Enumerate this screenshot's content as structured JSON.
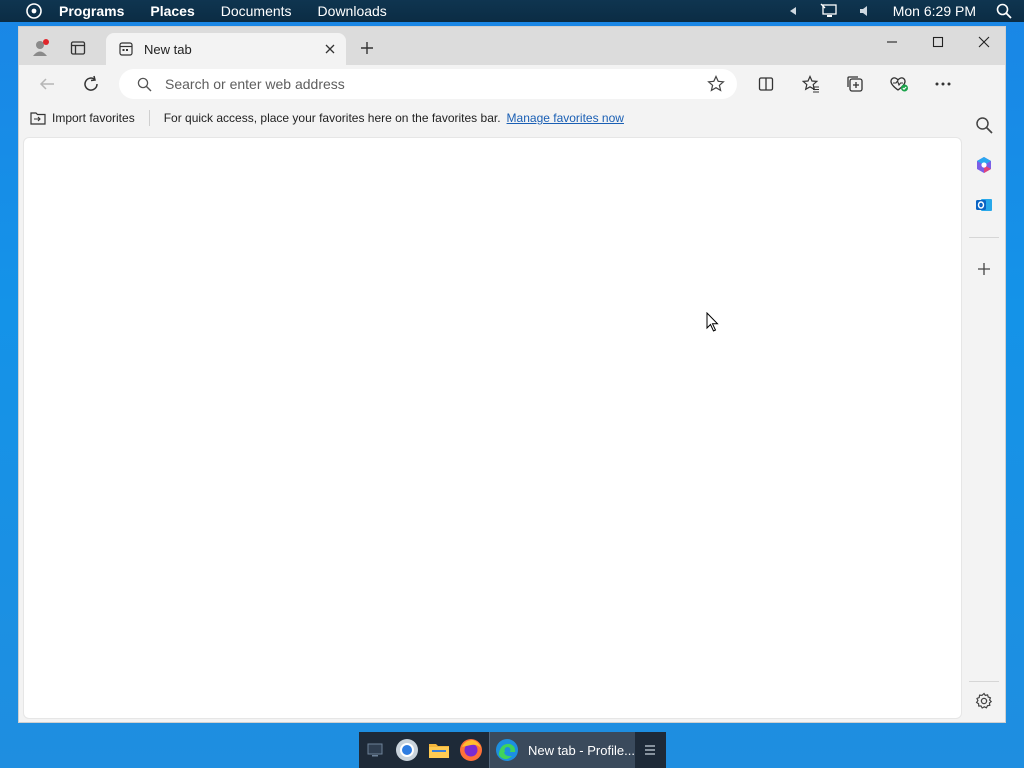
{
  "top_panel": {
    "menu": [
      "Programs",
      "Places",
      "Documents",
      "Downloads"
    ],
    "clock": "Mon 6:29 PM"
  },
  "browser": {
    "tab_title": "New tab",
    "address_placeholder": "Search or enter web address",
    "favorites_bar": {
      "import_label": "Import favorites",
      "message": "For quick access, place your favorites here on the favorites bar.",
      "manage_link": "Manage favorites now"
    }
  },
  "taskbar": {
    "window_label": "New tab - Profile..."
  },
  "colors": {
    "desktop": "#1493e8",
    "panel": "#0b2c44",
    "link": "#1a5fb4"
  }
}
